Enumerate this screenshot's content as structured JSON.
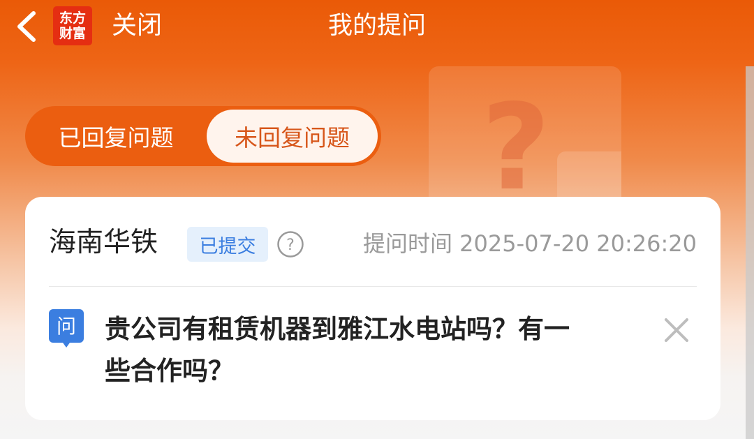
{
  "header": {
    "back_icon": "chevron-left-icon",
    "logo_line1": "东方",
    "logo_line2": "财富",
    "close_label": "关闭",
    "title": "我的提问"
  },
  "tabs": {
    "replied": "已回复问题",
    "unreplied": "未回复问题",
    "active": "unreplied"
  },
  "question_card": {
    "company": "海南华铁",
    "status": "已提交",
    "ask_time": "提问时间 2025-07-20 20:26:20",
    "question_tag": "问",
    "question": "贵公司有租赁机器到雅江水电站吗？有一些合作吗？"
  },
  "colors": {
    "brand_orange": "#ea5a07",
    "logo_red": "#e52e12",
    "badge_blue": "#3b7ee0",
    "active_tab_text": "#d7561a"
  }
}
